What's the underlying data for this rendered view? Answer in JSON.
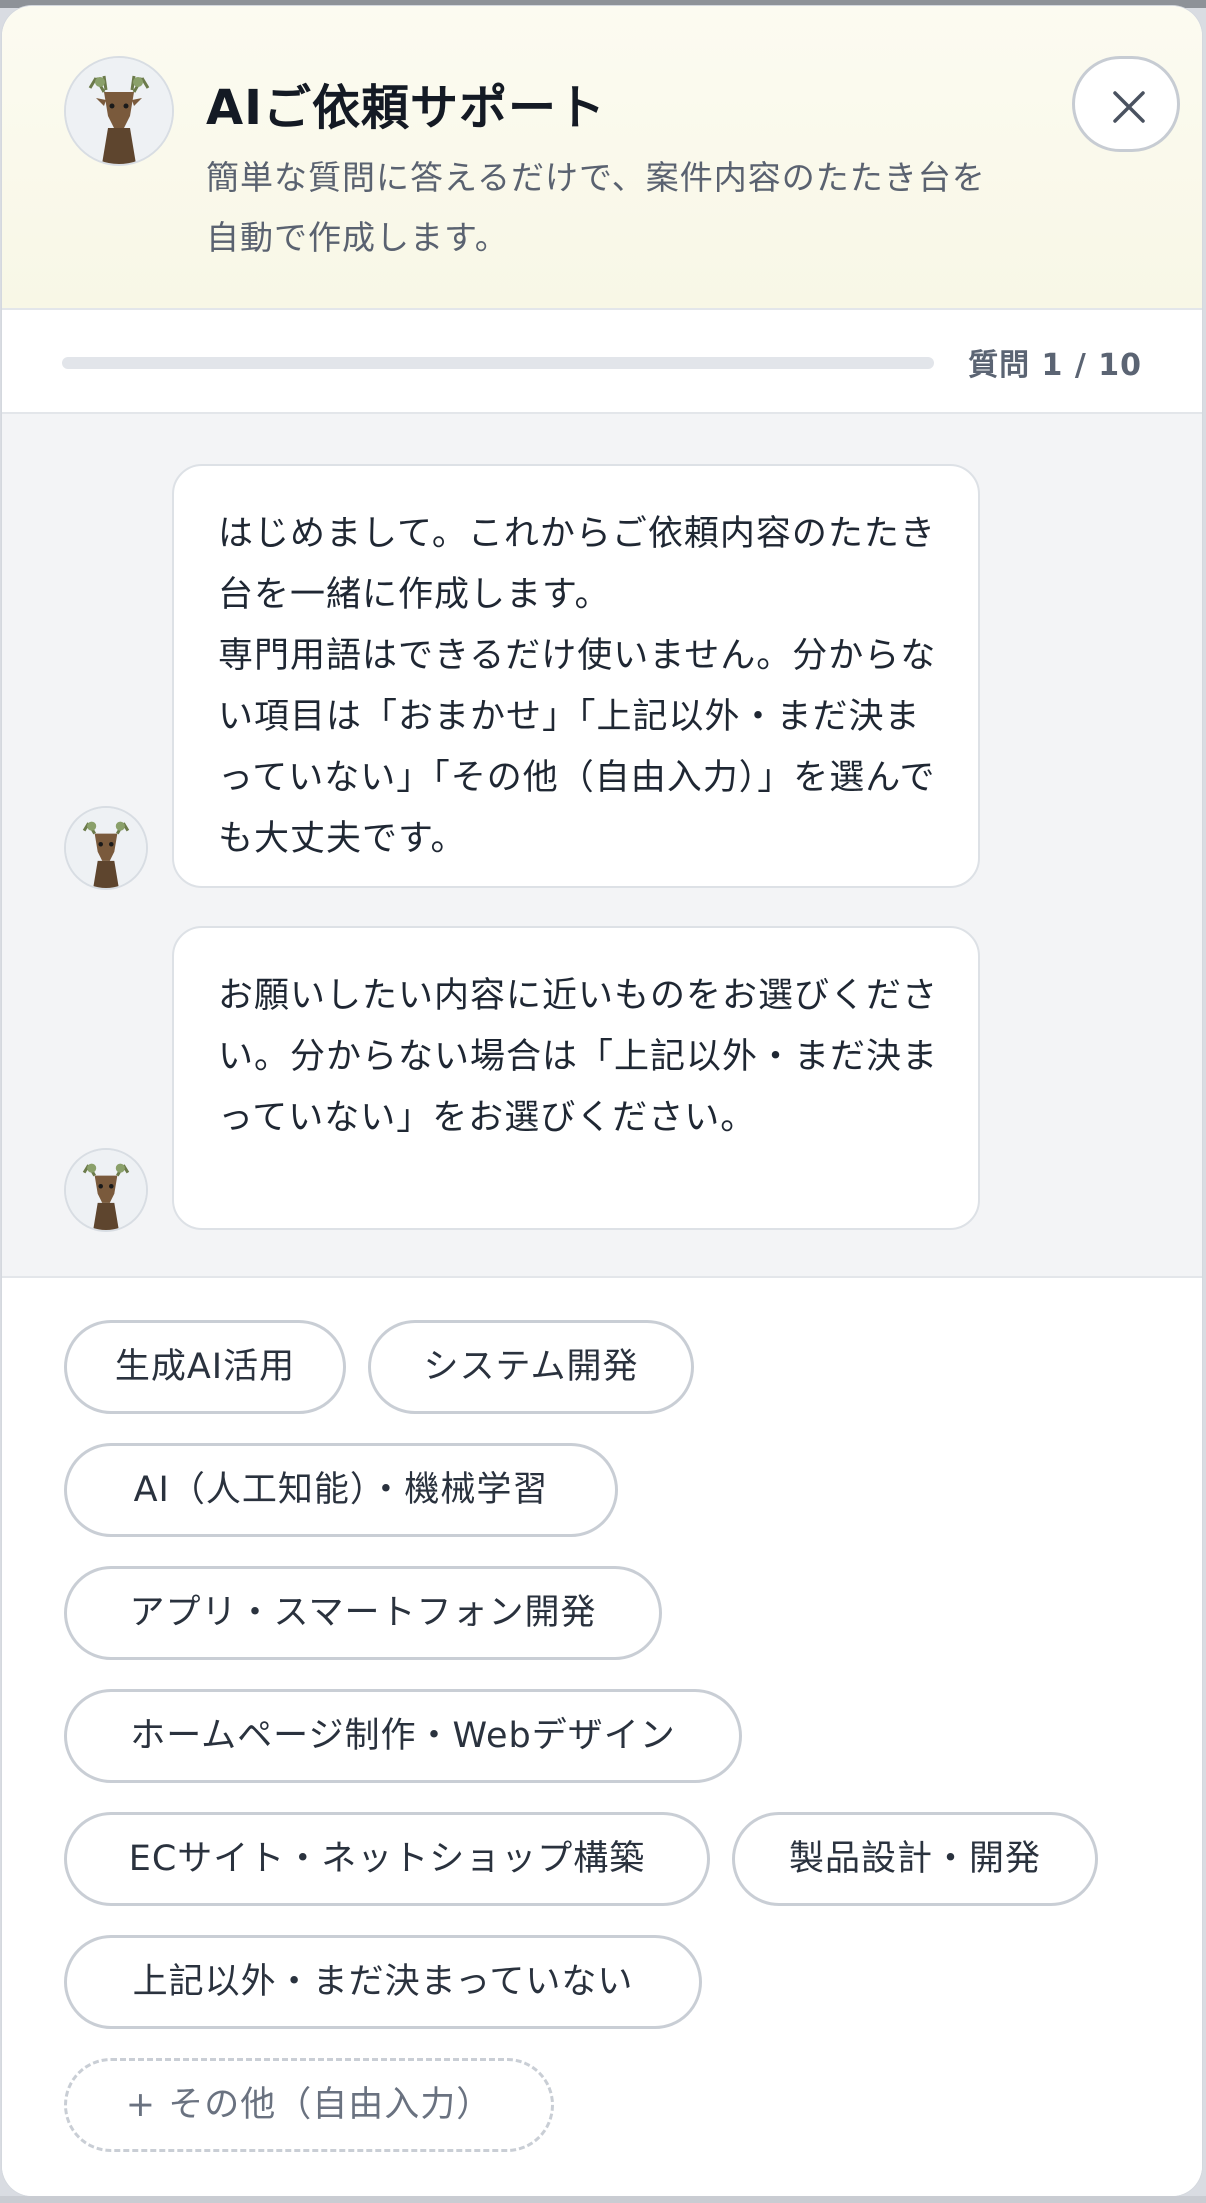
{
  "header": {
    "title": "AIご依頼サポート",
    "subtitle": "簡単な質問に答えるだけで、案件内容のたたき台を自動で作成します。",
    "close_icon": "close-icon",
    "avatar_icon": "deer-avatar-icon"
  },
  "progress": {
    "label": "質問 1 / 10",
    "current": 1,
    "total": 10,
    "fill_fraction": 0.0
  },
  "chat": {
    "messages": [
      {
        "text": "はじめまして。これからご依頼内容のたたき台を一緒に作成します。\n専門用語はできるだけ使いません。分からない項目は「おまかせ」「上記以外・まだ決まっていない」「その他（自由入力）」を選んでも大丈夫です。"
      },
      {
        "text": "お願いしたい内容に近いものをお選びください。分からない場合は「上記以外・まだ決まっていない」をお選びください。"
      }
    ]
  },
  "options": {
    "choices": [
      "生成AI活用",
      "システム開発",
      "AI（人工知能）・機械学習",
      "アプリ・スマートフォン開発",
      "ホームページ制作・Webデザイン",
      "ECサイト・ネットショップ構築",
      "製品設計・開発",
      "上記以外・まだ決まっていない"
    ],
    "free_input": "+ その他（自由入力）"
  },
  "colors": {
    "accent": "#3f8f6b",
    "header_bg": "#fcfbf1",
    "chat_bg": "#f3f4f6",
    "border": "#c9ced5"
  }
}
